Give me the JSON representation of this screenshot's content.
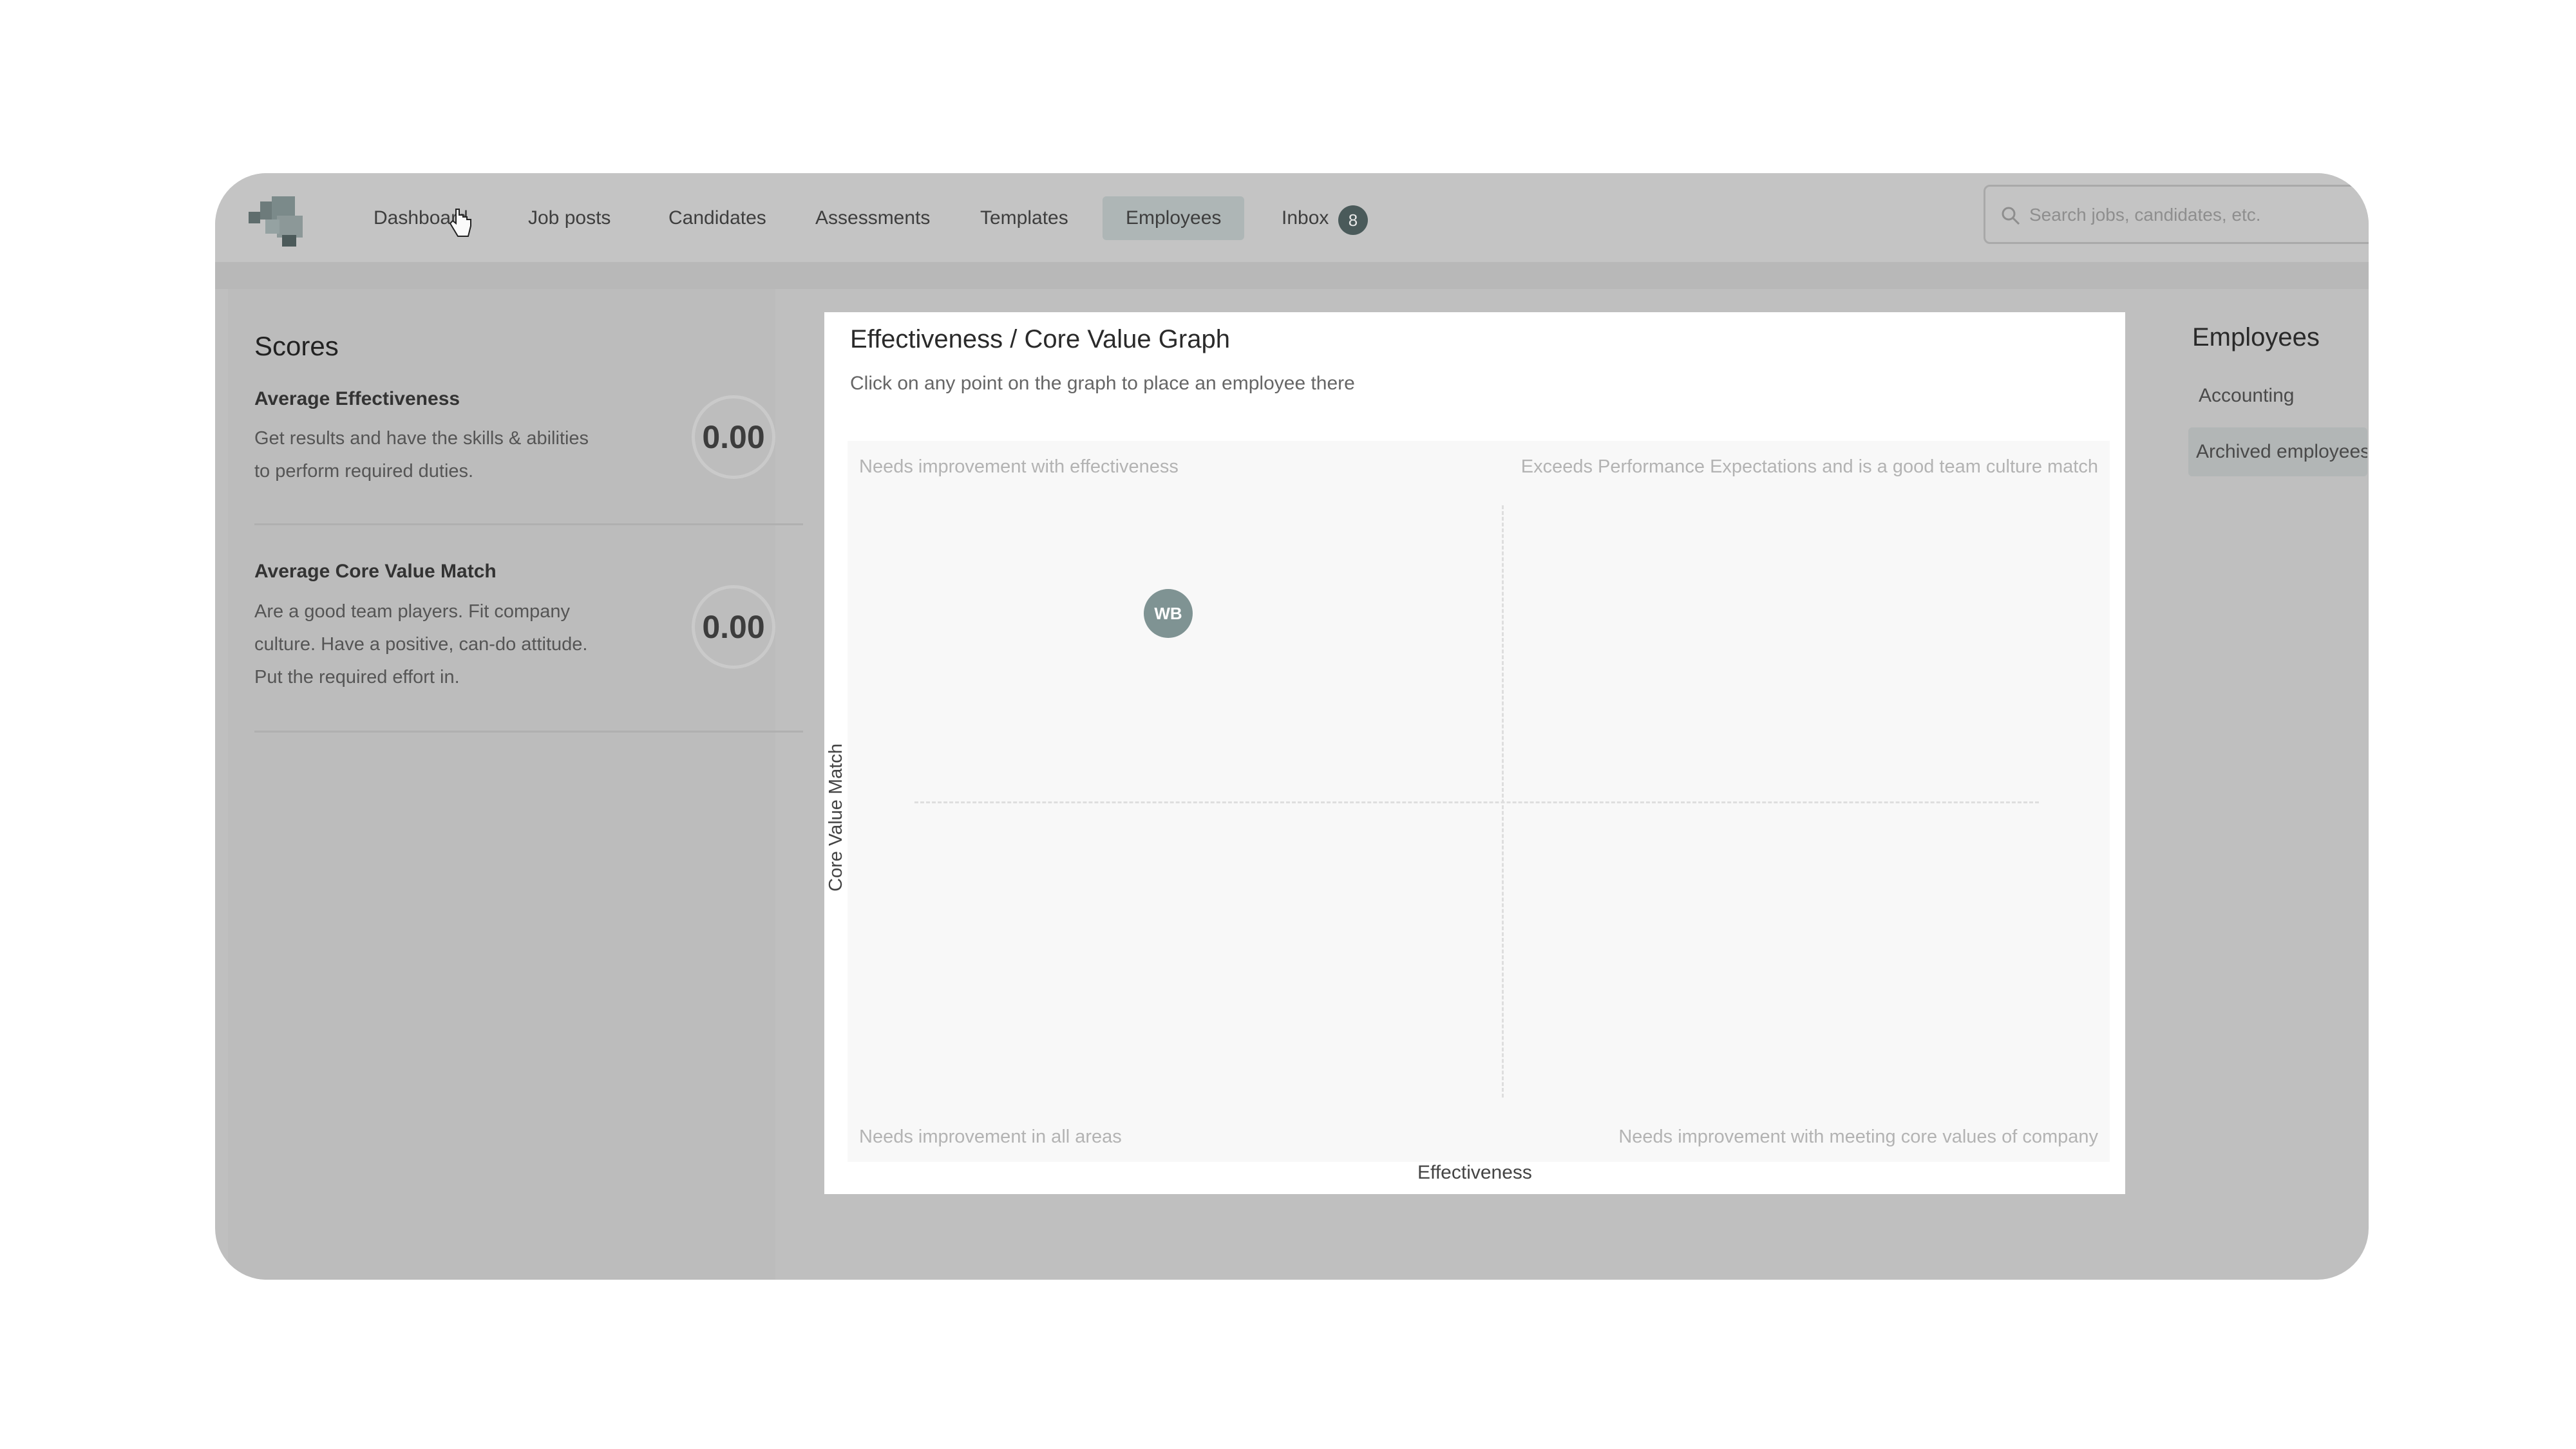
{
  "nav": {
    "items": [
      {
        "label": "Dashboard"
      },
      {
        "label": "Job posts"
      },
      {
        "label": "Candidates"
      },
      {
        "label": "Assessments"
      },
      {
        "label": "Templates"
      },
      {
        "label": "Employees",
        "active": true
      },
      {
        "label": "Inbox"
      }
    ],
    "inbox_badge": "8"
  },
  "search": {
    "placeholder": "Search jobs, candidates, etc."
  },
  "scores": {
    "title": "Scores",
    "effectiveness": {
      "label": "Average Effectiveness",
      "description": "Get results and have the skills & abilities to perform required duties.",
      "value": "0.00"
    },
    "core_value": {
      "label": "Average Core Value Match",
      "description": "Are a good team players. Fit company culture. Have a positive, can-do attitude. Put the required effort in.",
      "value": "0.00"
    }
  },
  "graph": {
    "title": "Effectiveness / Core Value Graph",
    "subtitle": "Click on any point on the graph to place an employee there",
    "quadrants": {
      "top_left": "Needs improvement with effectiveness",
      "top_right": "Exceeds Performance Expectations and is a good team culture match",
      "bottom_left": "Needs improvement in all areas",
      "bottom_right": "Needs improvement with meeting core values of company"
    },
    "xlabel": "Effectiveness",
    "ylabel": "Core Value Match",
    "points": [
      {
        "initials": "WB"
      }
    ]
  },
  "employees": {
    "title": "Employees",
    "groups": [
      "Accounting",
      "Archived employees"
    ]
  },
  "colors": {
    "point": "#7f9393",
    "badge": "#4a5a5a",
    "active_tab": "#aeb6b6"
  }
}
